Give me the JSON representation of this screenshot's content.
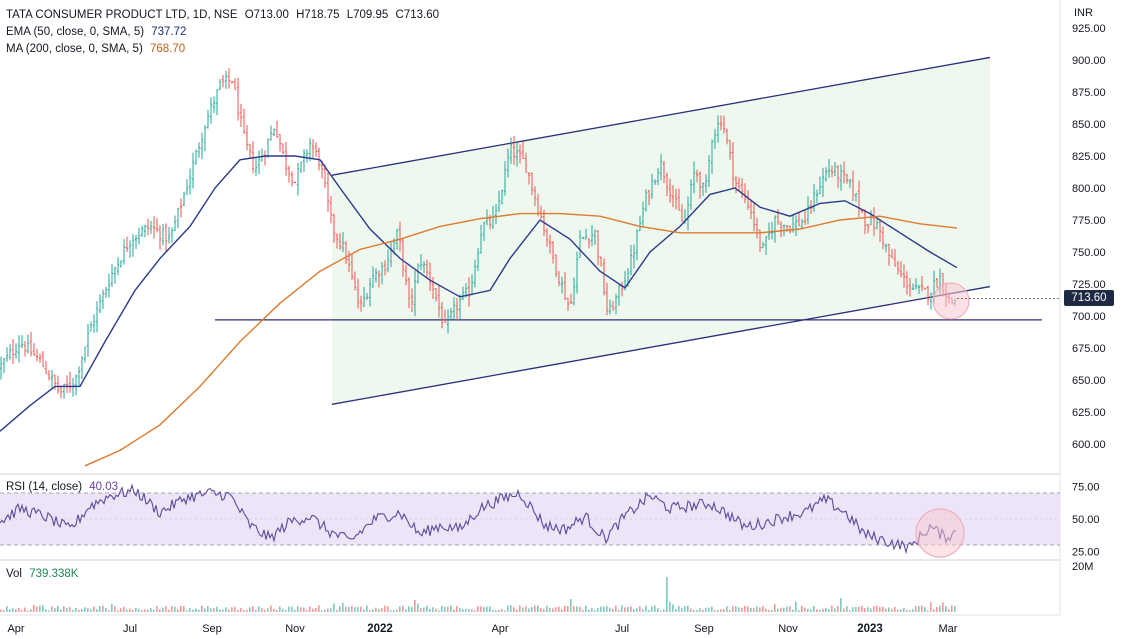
{
  "header": {
    "symbol": "TATA CONSUMER PRODUCT LTD, 1D, NSE",
    "open": "O713.00",
    "high": "H718.75",
    "low": "L709.95",
    "close": "C713.60"
  },
  "indicators": {
    "ema_label": "EMA (50, close, 0, SMA, 5)",
    "ema_value": "737.72",
    "ma_label": "MA (200, close, 0, SMA, 5)",
    "ma_value": "768.70",
    "rsi_label": "RSI (14, close)",
    "rsi_value": "40.03",
    "vol_label": "Vol",
    "vol_value": "739.338K"
  },
  "price_axis": {
    "currency": "INR",
    "last_price_tag": "713.60",
    "vol_scale_label": "20M"
  },
  "colors": {
    "up": "#26a69a",
    "down": "#ef5350",
    "ema": "#2a3a8c",
    "ma": "#e07a2e",
    "channel": "#2a2f7a",
    "channel_fill": "#e8f5e9",
    "rsi": "#5b4a9a",
    "rsi_band": "#ede4f7"
  },
  "chart_data": [
    {
      "type": "candlestick",
      "title": "TATA CONSUMER PRODUCT LTD, 1D, NSE",
      "xlabel": "",
      "ylabel": "INR",
      "x_ticks": [
        "Apr",
        "Jul",
        "Sep",
        "Nov",
        "2022",
        "Apr",
        "Jul",
        "Sep",
        "Nov",
        "2023",
        "Mar"
      ],
      "y_ticks": [
        "600.00",
        "625.00",
        "650.00",
        "675.00",
        "700.00",
        "725.00",
        "750.00",
        "775.00",
        "800.00",
        "825.00",
        "850.00",
        "875.00",
        "900.00",
        "925.00"
      ],
      "ylim": [
        580,
        935
      ],
      "price_path": [
        [
          0,
          660
        ],
        [
          20,
          680
        ],
        [
          40,
          665
        ],
        [
          60,
          640
        ],
        [
          75,
          650
        ],
        [
          90,
          690
        ],
        [
          110,
          730
        ],
        [
          130,
          760
        ],
        [
          150,
          770
        ],
        [
          170,
          760
        ],
        [
          190,
          810
        ],
        [
          205,
          850
        ],
        [
          220,
          880
        ],
        [
          232,
          885
        ],
        [
          245,
          835
        ],
        [
          255,
          815
        ],
        [
          265,
          830
        ],
        [
          275,
          850
        ],
        [
          285,
          820
        ],
        [
          295,
          805
        ],
        [
          310,
          835
        ],
        [
          320,
          820
        ],
        [
          332,
          770
        ],
        [
          345,
          750
        ],
        [
          360,
          705
        ],
        [
          372,
          730
        ],
        [
          385,
          740
        ],
        [
          398,
          765
        ],
        [
          410,
          705
        ],
        [
          420,
          745
        ],
        [
          432,
          725
        ],
        [
          445,
          690
        ],
        [
          458,
          710
        ],
        [
          470,
          720
        ],
        [
          482,
          770
        ],
        [
          495,
          775
        ],
        [
          510,
          830
        ],
        [
          525,
          820
        ],
        [
          540,
          780
        ],
        [
          555,
          740
        ],
        [
          570,
          705
        ],
        [
          580,
          760
        ],
        [
          595,
          765
        ],
        [
          608,
          700
        ],
        [
          620,
          720
        ],
        [
          632,
          745
        ],
        [
          645,
          790
        ],
        [
          660,
          820
        ],
        [
          672,
          795
        ],
        [
          684,
          770
        ],
        [
          695,
          815
        ],
        [
          705,
          795
        ],
        [
          712,
          840
        ],
        [
          722,
          855
        ],
        [
          735,
          805
        ],
        [
          750,
          785
        ],
        [
          762,
          750
        ],
        [
          775,
          775
        ],
        [
          790,
          770
        ],
        [
          805,
          775
        ],
        [
          818,
          800
        ],
        [
          828,
          815
        ],
        [
          840,
          810
        ],
        [
          852,
          800
        ],
        [
          865,
          775
        ],
        [
          878,
          770
        ],
        [
          890,
          745
        ],
        [
          902,
          730
        ],
        [
          915,
          720
        ],
        [
          928,
          718
        ],
        [
          940,
          730
        ],
        [
          950,
          710
        ],
        [
          957,
          713.6
        ]
      ],
      "ema_50": [
        [
          0,
          610
        ],
        [
          30,
          630
        ],
        [
          55,
          645
        ],
        [
          80,
          645
        ],
        [
          105,
          680
        ],
        [
          135,
          720
        ],
        [
          160,
          745
        ],
        [
          190,
          770
        ],
        [
          215,
          800
        ],
        [
          240,
          822
        ],
        [
          265,
          825
        ],
        [
          295,
          825
        ],
        [
          320,
          822
        ],
        [
          340,
          800
        ],
        [
          370,
          768
        ],
        [
          400,
          745
        ],
        [
          430,
          728
        ],
        [
          460,
          715
        ],
        [
          490,
          720
        ],
        [
          510,
          745
        ],
        [
          540,
          775
        ],
        [
          570,
          760
        ],
        [
          600,
          735
        ],
        [
          625,
          722
        ],
        [
          650,
          750
        ],
        [
          680,
          770
        ],
        [
          710,
          795
        ],
        [
          735,
          800
        ],
        [
          760,
          785
        ],
        [
          790,
          778
        ],
        [
          820,
          788
        ],
        [
          845,
          790
        ],
        [
          870,
          780
        ],
        [
          900,
          765
        ],
        [
          930,
          750
        ],
        [
          957,
          737.72
        ]
      ],
      "ma_200": [
        [
          85,
          583
        ],
        [
          120,
          595
        ],
        [
          160,
          615
        ],
        [
          200,
          645
        ],
        [
          240,
          680
        ],
        [
          280,
          710
        ],
        [
          320,
          735
        ],
        [
          360,
          752
        ],
        [
          400,
          760
        ],
        [
          440,
          770
        ],
        [
          480,
          776
        ],
        [
          520,
          780
        ],
        [
          560,
          780
        ],
        [
          600,
          778
        ],
        [
          640,
          770
        ],
        [
          680,
          765
        ],
        [
          720,
          765
        ],
        [
          760,
          765
        ],
        [
          800,
          768
        ],
        [
          840,
          775
        ],
        [
          880,
          778
        ],
        [
          920,
          772
        ],
        [
          957,
          768.7
        ]
      ],
      "channel_upper": [
        [
          332,
          810
        ],
        [
          990,
          902
        ]
      ],
      "channel_lower": [
        [
          332,
          631
        ],
        [
          990,
          723
        ]
      ],
      "support_level": 697,
      "last_price": 713.6,
      "annotation": "highlight circle near last price"
    },
    {
      "type": "line",
      "title": "RSI (14, close)",
      "y_ticks": [
        "25.00",
        "50.00",
        "75.00"
      ],
      "ylim": [
        20,
        80
      ],
      "band": [
        30,
        70
      ],
      "last_value": 40.03,
      "series": [
        {
          "name": "RSI (14, close)",
          "values_path": [
            [
              0,
              48
            ],
            [
              20,
              58
            ],
            [
              45,
              52
            ],
            [
              70,
              42
            ],
            [
              90,
              60
            ],
            [
              110,
              68
            ],
            [
              135,
              72
            ],
            [
              160,
              55
            ],
            [
              185,
              66
            ],
            [
              210,
              70
            ],
            [
              230,
              68
            ],
            [
              250,
              45
            ],
            [
              270,
              35
            ],
            [
              290,
              48
            ],
            [
              310,
              52
            ],
            [
              330,
              40
            ],
            [
              350,
              33
            ],
            [
              375,
              50
            ],
            [
              400,
              55
            ],
            [
              420,
              38
            ],
            [
              440,
              45
            ],
            [
              460,
              42
            ],
            [
              480,
              58
            ],
            [
              500,
              65
            ],
            [
              520,
              70
            ],
            [
              545,
              45
            ],
            [
              565,
              42
            ],
            [
              585,
              52
            ],
            [
              605,
              35
            ],
            [
              625,
              52
            ],
            [
              650,
              68
            ],
            [
              670,
              58
            ],
            [
              690,
              60
            ],
            [
              710,
              62
            ],
            [
              725,
              55
            ],
            [
              745,
              44
            ],
            [
              765,
              47
            ],
            [
              785,
              52
            ],
            [
              805,
              55
            ],
            [
              825,
              65
            ],
            [
              845,
              55
            ],
            [
              865,
              38
            ],
            [
              890,
              32
            ],
            [
              910,
              28
            ],
            [
              930,
              44
            ],
            [
              945,
              36
            ],
            [
              957,
              40
            ]
          ]
        }
      ]
    },
    {
      "type": "bar",
      "title": "Vol",
      "ylim": [
        0,
        20000000
      ],
      "last_value": 739338,
      "spikes": [
        [
          415,
          6000000
        ],
        [
          570,
          6500000
        ],
        [
          668,
          17500000
        ],
        [
          840,
          7000000
        ]
      ]
    }
  ]
}
